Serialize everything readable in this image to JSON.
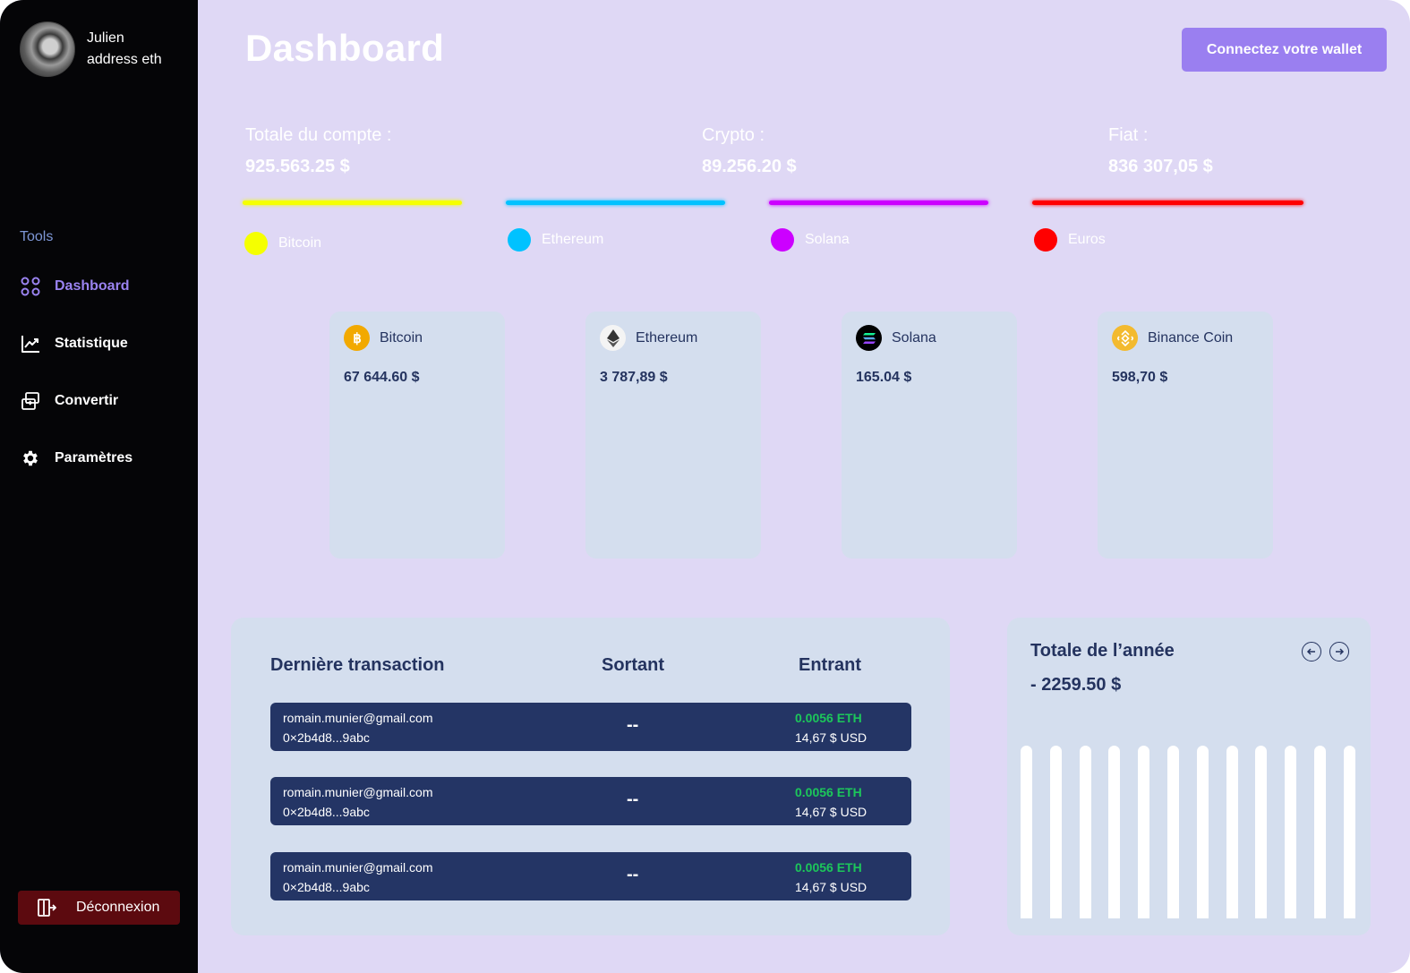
{
  "user": {
    "name": "Julien",
    "address": "address eth"
  },
  "sidebar": {
    "section_label": "Tools",
    "items": [
      {
        "label": "Dashboard",
        "icon": "dashboard-grid-icon",
        "active": true
      },
      {
        "label": "Statistique",
        "icon": "chart-line-icon",
        "active": false
      },
      {
        "label": "Convertir",
        "icon": "convert-icon",
        "active": false
      },
      {
        "label": "Paramètres",
        "icon": "gear-icon",
        "active": false
      }
    ],
    "logout_label": "Déconnexion"
  },
  "header": {
    "title": "Dashboard",
    "wallet_button": "Connectez votre wallet"
  },
  "stats": [
    {
      "label": "Totale du compte :",
      "value": "925.563.25 $"
    },
    {
      "label": "Crypto :",
      "value": "89.256.20 $"
    },
    {
      "label": "Fiat :",
      "value": "836 307,05 $"
    }
  ],
  "allocation": [
    {
      "name": "Bitcoin",
      "color": "#f5ff00"
    },
    {
      "name": "Ethereum",
      "color": "#00c2ff"
    },
    {
      "name": "Solana",
      "color": "#cc00ff"
    },
    {
      "name": "Euros",
      "color": "#ff0000"
    }
  ],
  "coins": [
    {
      "name": "Bitcoin",
      "price": "67 644.60 $",
      "icon": "bitcoin-icon"
    },
    {
      "name": "Ethereum",
      "price": "3 787,89 $",
      "icon": "ethereum-icon"
    },
    {
      "name": "Solana",
      "price": "165.04 $",
      "icon": "solana-icon"
    },
    {
      "name": "Binance Coin",
      "price": "598,70 $",
      "icon": "binance-icon"
    }
  ],
  "transactions": {
    "headers": {
      "title": "Dernière transaction",
      "out": "Sortant",
      "in": "Entrant"
    },
    "rows": [
      {
        "email": "romain.munier@gmail.com",
        "address": "0×2b4d8...9abc",
        "out": "--",
        "in_amount": "0.0056 ETH",
        "in_usd": "14,67 $ USD"
      },
      {
        "email": "romain.munier@gmail.com",
        "address": "0×2b4d8...9abc",
        "out": "--",
        "in_amount": "0.0056 ETH",
        "in_usd": "14,67 $ USD"
      },
      {
        "email": "romain.munier@gmail.com",
        "address": "0×2b4d8...9abc",
        "out": "--",
        "in_amount": "0.0056 ETH",
        "in_usd": "14,67 $ USD"
      }
    ]
  },
  "year_summary": {
    "title": "Totale de l’année",
    "value": "- 2259.50 $",
    "bar_levels": [
      1,
      1,
      1,
      1,
      1,
      1,
      1,
      1,
      1,
      1,
      1,
      1
    ]
  }
}
